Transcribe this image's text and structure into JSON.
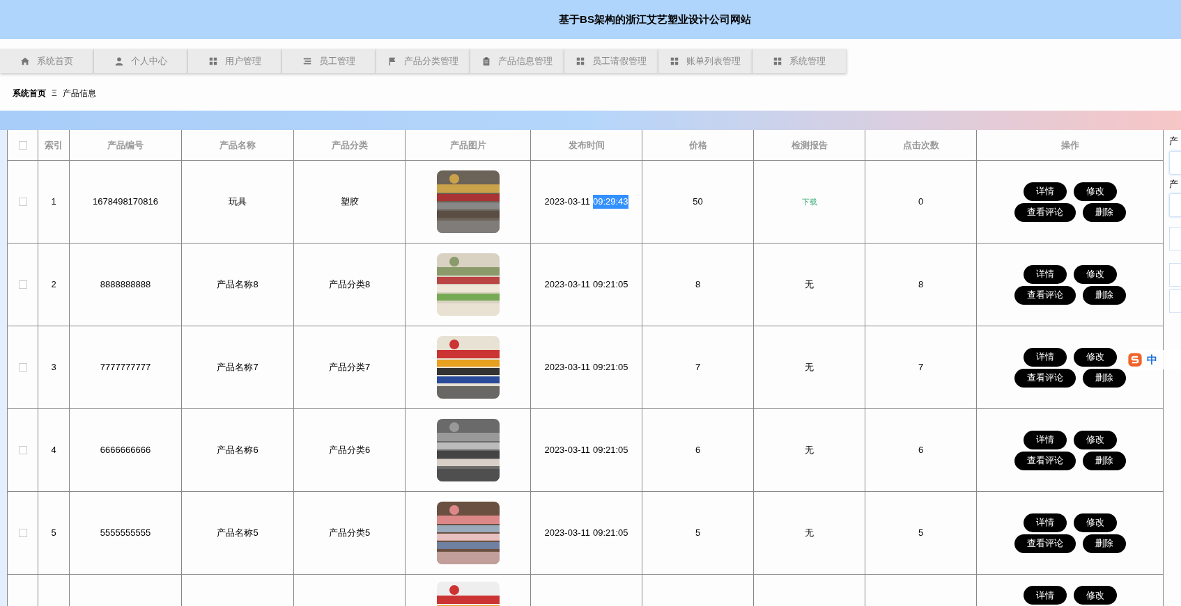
{
  "header": {
    "title": "基于BS架构的浙江艾艺塑业设计公司网站"
  },
  "nav": [
    {
      "label": "系统首页"
    },
    {
      "label": "个人中心"
    },
    {
      "label": "用户管理"
    },
    {
      "label": "员工管理"
    },
    {
      "label": "产品分类管理"
    },
    {
      "label": "产品信息管理"
    },
    {
      "label": "员工请假管理"
    },
    {
      "label": "账单列表管理"
    },
    {
      "label": "系统管理"
    }
  ],
  "breadcrumb": {
    "home": "系统首页",
    "separator": "Ξ",
    "current": "产品信息"
  },
  "table": {
    "header_checked": false,
    "columns": [
      "索引",
      "产品编号",
      "产品名称",
      "产品分类",
      "产品图片",
      "发布时间",
      "价格",
      "检测报告",
      "点击次数",
      "操作"
    ],
    "rows": [
      {
        "checked": false,
        "index": "1",
        "code": "1678498170816",
        "name": "玩具",
        "category": "塑胶",
        "date": "2023-03-11",
        "time": "09:29:43",
        "time_selected": true,
        "price": "50",
        "report": {
          "kind": "link",
          "text": "下载"
        },
        "clicks": "0",
        "actions": [
          "详情",
          "修改",
          "查看评论",
          "删除"
        ]
      },
      {
        "checked": false,
        "index": "2",
        "code": "8888888888",
        "name": "产品名称8",
        "category": "产品分类8",
        "date": "2023-03-11",
        "time": "09:21:05",
        "time_selected": false,
        "price": "8",
        "report": {
          "kind": "text",
          "text": "无"
        },
        "clicks": "8",
        "actions": [
          "详情",
          "修改",
          "查看评论",
          "删除"
        ]
      },
      {
        "checked": false,
        "index": "3",
        "code": "7777777777",
        "name": "产品名称7",
        "category": "产品分类7",
        "date": "2023-03-11",
        "time": "09:21:05",
        "time_selected": false,
        "price": "7",
        "report": {
          "kind": "text",
          "text": "无"
        },
        "clicks": "7",
        "actions": [
          "详情",
          "修改",
          "查看评论",
          "删除"
        ]
      },
      {
        "checked": false,
        "index": "4",
        "code": "6666666666",
        "name": "产品名称6",
        "category": "产品分类6",
        "date": "2023-03-11",
        "time": "09:21:05",
        "time_selected": false,
        "price": "6",
        "report": {
          "kind": "text",
          "text": "无"
        },
        "clicks": "6",
        "actions": [
          "详情",
          "修改",
          "查看评论",
          "删除"
        ]
      },
      {
        "checked": false,
        "index": "5",
        "code": "5555555555",
        "name": "产品名称5",
        "category": "产品分类5",
        "date": "2023-03-11",
        "time": "09:21:05",
        "time_selected": false,
        "price": "5",
        "report": {
          "kind": "text",
          "text": "无"
        },
        "clicks": "5",
        "actions": [
          "详情",
          "修改",
          "查看评论",
          "删除"
        ]
      }
    ],
    "partial_row": {
      "actions": [
        "详情",
        "修改"
      ]
    }
  },
  "side_form": {
    "labels": [
      "产",
      "产"
    ]
  },
  "ime_toolbar": {
    "mode": "中"
  }
}
